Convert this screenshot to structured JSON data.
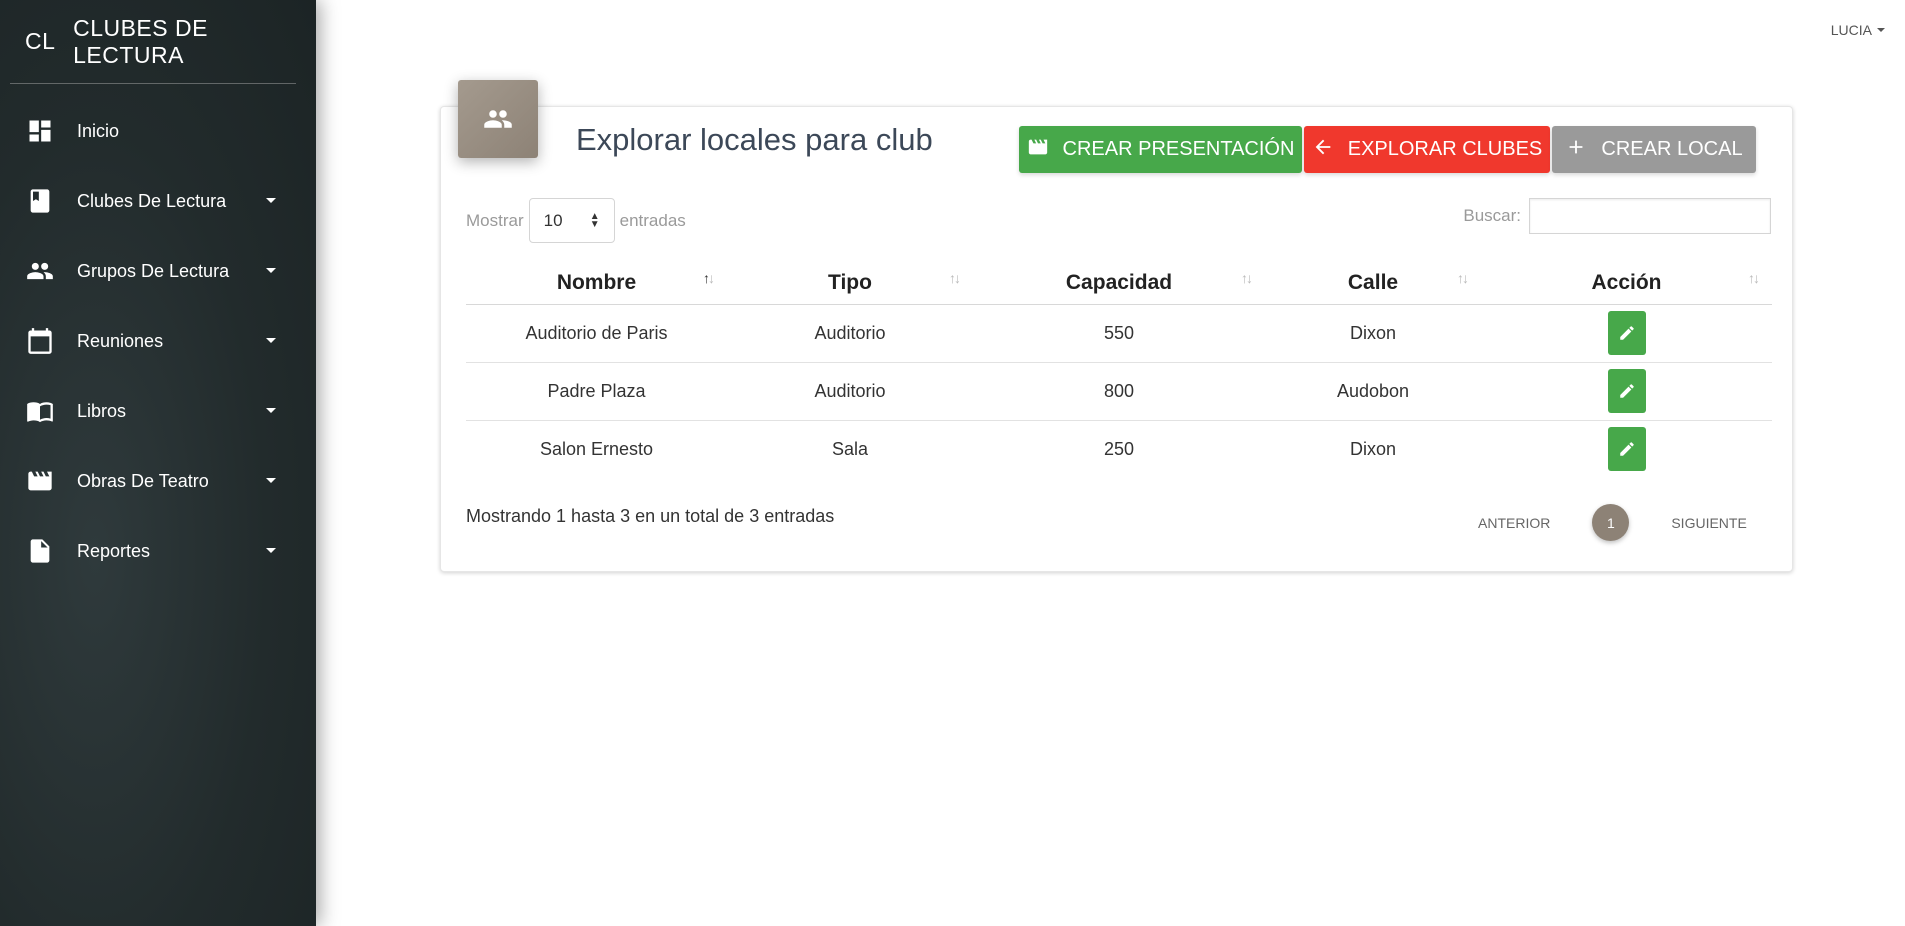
{
  "sidebar": {
    "brand_mini": "CL",
    "brand_title": "CLUBES DE LECTURA",
    "items": [
      {
        "label": "Inicio",
        "icon": "dashboard-icon"
      },
      {
        "label": "Clubes De Lectura",
        "icon": "book-icon"
      },
      {
        "label": "Grupos De Lectura",
        "icon": "people-icon"
      },
      {
        "label": "Reuniones",
        "icon": "calendar-icon"
      },
      {
        "label": "Libros",
        "icon": "open-book-icon"
      },
      {
        "label": "Obras De Teatro",
        "icon": "theater-icon"
      },
      {
        "label": "Reportes",
        "icon": "document-icon"
      }
    ]
  },
  "header": {
    "user": "LUCIA"
  },
  "card": {
    "title": "Explorar locales para club",
    "icon": "people-icon",
    "buttons": {
      "create_presentation": "CREAR PRESENTACIÓN",
      "explore_clubs": "EXPLORAR CLUBES",
      "create_local": "CREAR LOCAL"
    }
  },
  "table_controls": {
    "show_label": "Mostrar",
    "page_size": "10",
    "entries_label": "entradas",
    "search_label": "Buscar:",
    "search_value": ""
  },
  "table": {
    "columns": [
      "Nombre",
      "Tipo",
      "Capacidad",
      "Calle",
      "Acción"
    ],
    "rows": [
      [
        "Auditorio de Paris",
        "Auditorio",
        "550",
        "Dixon"
      ],
      [
        "Padre Plaza",
        "Auditorio",
        "800",
        "Audobon"
      ],
      [
        "Salon Ernesto",
        "Sala",
        "250",
        "Dixon"
      ]
    ]
  },
  "footer": {
    "info": "Mostrando 1 hasta 3 en un total de 3 entradas",
    "prev": "ANTERIOR",
    "current_page": "1",
    "next": "SIGUIENTE"
  },
  "colors": {
    "sidebar_bg": "#222b2c",
    "green": "#47a84a",
    "red": "#f0382d",
    "grey": "#9a9a9a",
    "accent_brown": "#8d8276"
  }
}
